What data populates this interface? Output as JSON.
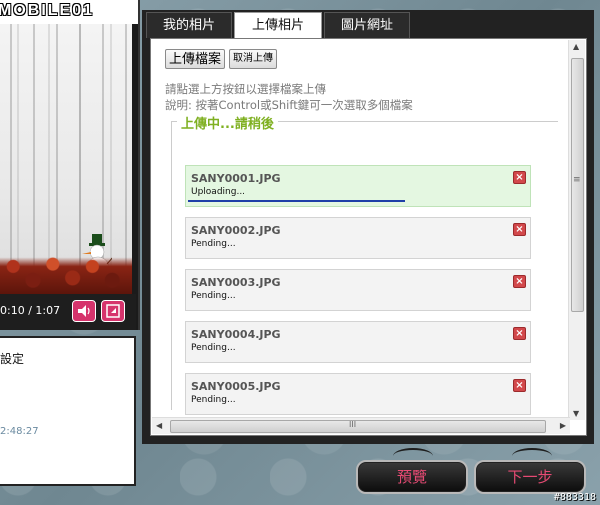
{
  "player": {
    "logo": "MOBILE01",
    "time": "0:10 / 1:07"
  },
  "info": {
    "title": "設定",
    "timestamp": "2:48:27"
  },
  "tabs": [
    {
      "label": "我的相片",
      "active": false
    },
    {
      "label": "上傳相片",
      "active": true
    },
    {
      "label": "圖片網址",
      "active": false
    }
  ],
  "upload": {
    "upload_button": "上傳檔案",
    "cancel_button": "取消上傳",
    "hint1": "請點選上方按鈕以選擇檔案上傳",
    "hint2": "說明: 按著Control或Shift鍵可一次選取多個檔案",
    "legend": "上傳中...請稍後",
    "files": [
      {
        "name": "SANY0001.JPG",
        "status": "Uploading...",
        "progress": 0.63
      },
      {
        "name": "SANY0002.JPG",
        "status": "Pending..."
      },
      {
        "name": "SANY0003.JPG",
        "status": "Pending..."
      },
      {
        "name": "SANY0004.JPG",
        "status": "Pending..."
      },
      {
        "name": "SANY0005.JPG",
        "status": "Pending..."
      }
    ],
    "delete_icon": "×"
  },
  "scroll": {
    "hthumb_grip": "III",
    "vthumb_grip": "≡"
  },
  "footer": {
    "preview_button": "預覽",
    "next_button": "下一步",
    "watermark": "#883318"
  },
  "colors": {
    "accent_green": "#7fb021",
    "progress_blue": "#1f3fa8",
    "button_text_pink": "#e64a73",
    "delete_red": "#d2484b"
  }
}
